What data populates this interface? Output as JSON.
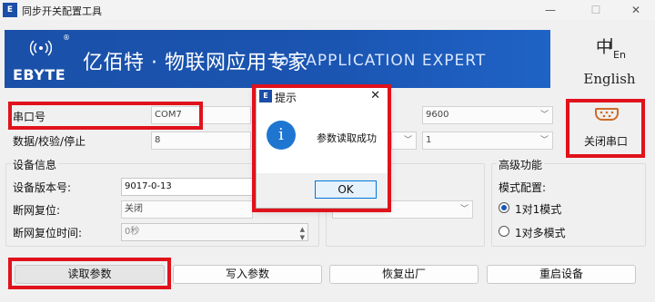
{
  "app": {
    "icon_text": "E",
    "title": "同步开关配置工具"
  },
  "window_controls": {
    "minimize": "—",
    "maximize": "☐",
    "close": "✕"
  },
  "banner": {
    "logo_text": "EBYTE",
    "logo_mark": "®",
    "slogan_cn": "亿佰特 · 物联网应用专家",
    "slogan_en": "IoT APPLICATION EXPERT"
  },
  "language": {
    "icon": "中/En",
    "label": "English"
  },
  "serial": {
    "port_label": "串口号",
    "port_value": "COM7",
    "baud_value": "9600",
    "format_label": "数据/校验/停止",
    "data_bits": "8",
    "stop_bits": "1"
  },
  "port_button": {
    "label": "关闭串口",
    "icon": "serial-port-icon"
  },
  "device_info": {
    "group_title": "设备信息",
    "version_label": "设备版本号:",
    "version_value": "9017-0-13",
    "reset_label": "断网复位:",
    "reset_value": "关闭",
    "reset_time_label": "断网复位时间:",
    "reset_time_value": "0秒"
  },
  "advanced": {
    "group_title": "高级功能",
    "mode_label": "模式配置:",
    "options": [
      "1对1模式",
      "1对多模式"
    ],
    "selected_index": 0
  },
  "buttons": {
    "read": "读取参数",
    "write": "写入参数",
    "restore": "恢复出厂",
    "restart": "重启设备"
  },
  "dialog": {
    "icon_text": "E",
    "title": "提示",
    "close": "✕",
    "info_icon": "i",
    "message": "参数读取成功",
    "ok": "OK"
  }
}
